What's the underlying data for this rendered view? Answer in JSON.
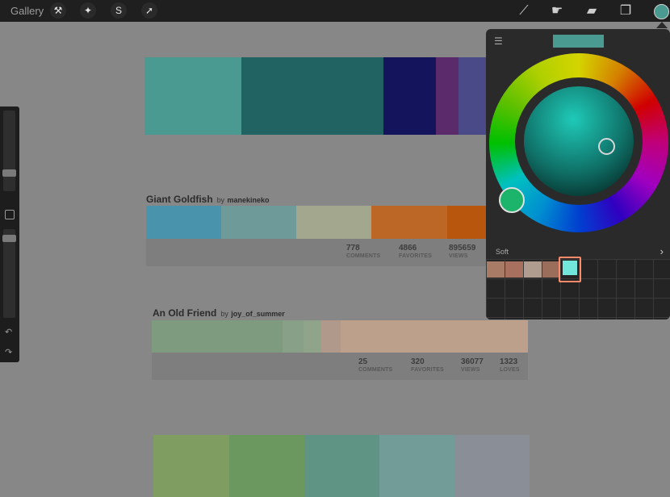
{
  "topbar": {
    "gallery_label": "Gallery",
    "icons": [
      "wrench-icon",
      "magic-wand-icon",
      "selection-icon",
      "arrow-icon"
    ],
    "tools": [
      "brush-icon",
      "smudge-icon",
      "eraser-icon",
      "layers-icon"
    ],
    "current_color": "#4a9a92"
  },
  "palettes": [
    {
      "title": "",
      "colors": [
        "#4a9a92",
        "#216363",
        "#14145c",
        "#5a2a6a",
        "#4a4a88"
      ]
    },
    {
      "title": "Giant Goldfish",
      "by": "by",
      "user": "manekineko",
      "colors": [
        "#4a93ad",
        "#6e9a99",
        "#a2a78e",
        "#bd6726",
        "#b8560e"
      ],
      "stats": [
        {
          "value": "778",
          "label": "COMMENTS"
        },
        {
          "value": "4866",
          "label": "FAVORITES"
        },
        {
          "value": "895659",
          "label": "VIEWS"
        }
      ]
    },
    {
      "title": "An Old Friend",
      "by": "by",
      "user": "joy_of_summer",
      "colors": [
        "#7e9b80",
        "#88a088",
        "#8fa48b",
        "#b0998a",
        "#bca08c"
      ],
      "stats": [
        {
          "value": "25",
          "label": "COMMENTS"
        },
        {
          "value": "320",
          "label": "FAVORITES"
        },
        {
          "value": "36077",
          "label": "VIEWS"
        },
        {
          "value": "1323",
          "label": "LOVES"
        }
      ]
    },
    {
      "title": "",
      "colors": [
        "#7f9d60",
        "#6a985f",
        "#5f9484",
        "#729c97",
        "#8a8f97"
      ]
    }
  ],
  "color_popover": {
    "current_color": "#4a9a92",
    "palette_name": "Soft",
    "swatches": [
      "#a87b66",
      "#a8705f",
      "#b19c90",
      "#9a6e5a"
    ],
    "selected_swatch": "#73e6dc"
  }
}
